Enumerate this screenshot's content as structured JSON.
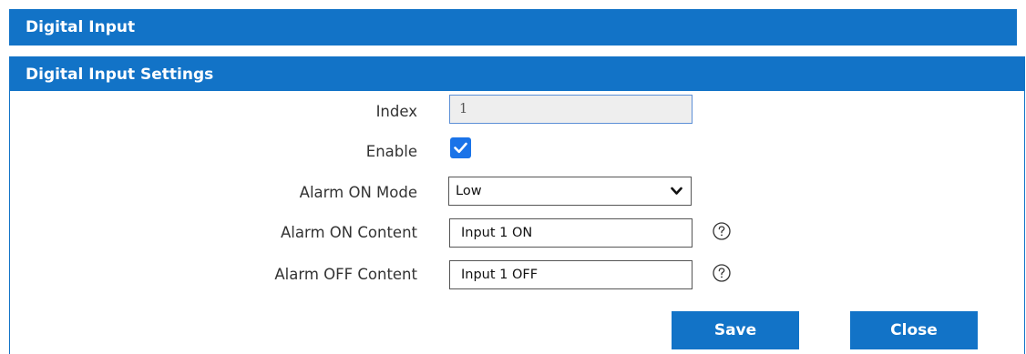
{
  "header": {
    "title": "Digital Input"
  },
  "section": {
    "title": "Digital Input Settings"
  },
  "form": {
    "index": {
      "label": "Index",
      "value": "1"
    },
    "enable": {
      "label": "Enable",
      "checked": true
    },
    "alarm_on_mode": {
      "label": "Alarm ON Mode",
      "selected": "Low"
    },
    "alarm_on_content": {
      "label": "Alarm ON Content",
      "value": "Input 1 ON"
    },
    "alarm_off_content": {
      "label": "Alarm OFF Content",
      "value": "Input 1 OFF"
    }
  },
  "buttons": {
    "save": "Save",
    "close": "Close"
  },
  "icons": {
    "checkbox": "checkmark-icon",
    "select": "chevron-down-icon",
    "help": "question-circle-icon"
  },
  "colors": {
    "accent": "#1273c7",
    "checkbox": "#1a73e8",
    "readonly_bg": "#eeeeee"
  }
}
